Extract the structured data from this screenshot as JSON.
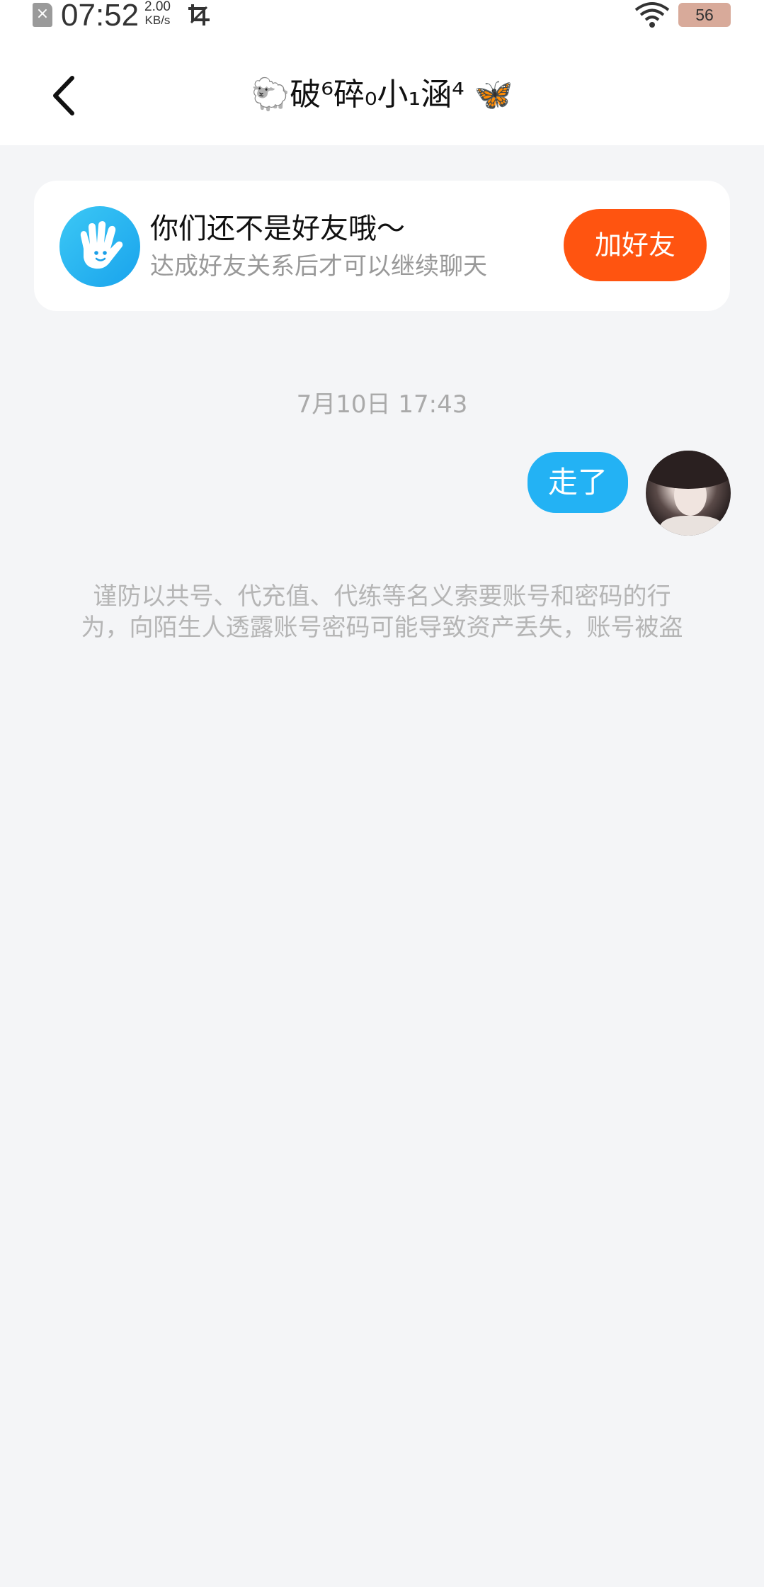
{
  "status_bar": {
    "time": "07:52",
    "net_speed_value": "2.00",
    "net_speed_unit": "KB/s",
    "battery": "56",
    "sim_icon": "sim-disabled-icon",
    "wifi_icon": "wifi-icon",
    "screenshot_icon": "crop-icon"
  },
  "header": {
    "title": "🐑破⁶碎₀小₁涵⁴ 🦋",
    "back_icon": "chevron-left-icon"
  },
  "friend_notice": {
    "title": "你们还不是好友哦～",
    "subtitle": "达成好友关系后才可以继续聊天",
    "button_label": "加好友",
    "icon": "wave-hand-icon",
    "button_color": "#ff5410"
  },
  "chat": {
    "timestamp": "7月10日 17:43",
    "messages": [
      {
        "text": "走了",
        "from": "self"
      }
    ],
    "bubble_color": "#23b2f4"
  },
  "warning": {
    "line1": "谨防以共号、代充值、代练等名义索要账号和密码的行",
    "line2": "为，向陌生人透露账号密码可能导致资产丢失，账号被盗"
  }
}
